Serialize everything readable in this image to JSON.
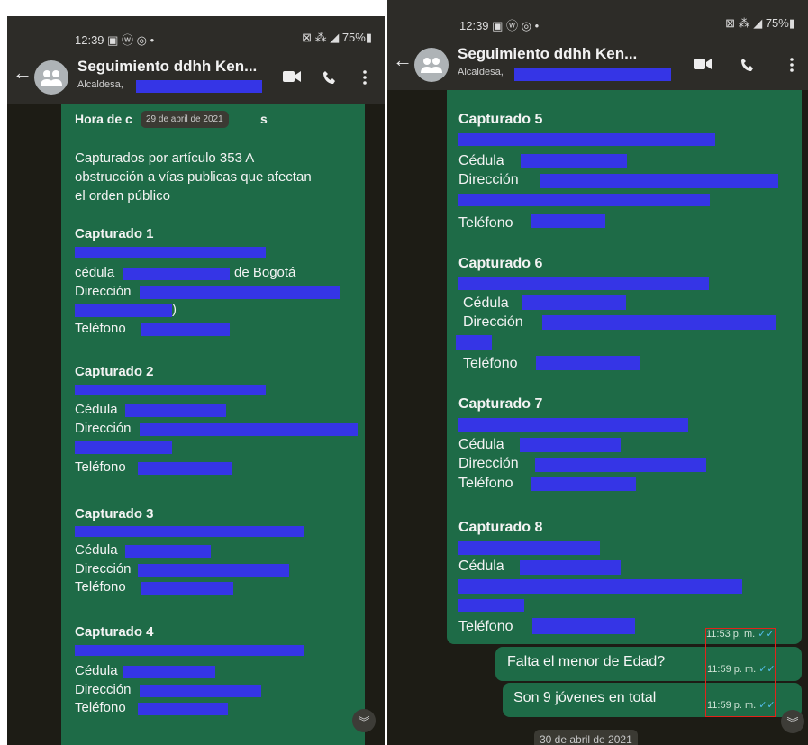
{
  "left_screen": {
    "status": {
      "time": "12:39 ▣ ⓦ ◎ •",
      "right": "⊠ ⁂ ◢ 75%▮"
    },
    "header": {
      "title": "Seguimiento ddhh Ken...",
      "subtitle": "Alcaldesa,"
    },
    "date_chip": "29 de abril de 2021",
    "message": {
      "heading_start": "Hora de c",
      "heading_end": "s",
      "intro": [
        "Capturados por artículo 353 A",
        "obstrucción a vías publicas que afectan",
        "el orden público"
      ],
      "c1_head": "Capturado 1",
      "c1_cedula": "cédula",
      "c1_bogota": "de Bogotá",
      "c1_dir": "Dirección",
      "c1_paren": ")",
      "c1_tel": "Teléfono",
      "c2_head": "Capturado 2",
      "c2_cedula": "Cédula",
      "c2_dir": "Dirección",
      "c2_tel": "Teléfono",
      "c3_head": "Capturado 3",
      "c3_cedula": "Cédula",
      "c3_dir": "Dirección",
      "c3_tel": "Teléfono",
      "c4_head": "Capturado 4",
      "c4_cedula": "Cédula",
      "c4_dir": "Dirección",
      "c4_tel": "Teléfono"
    }
  },
  "right_screen": {
    "status": {
      "time": "12:39 ▣ ⓦ ◎ •",
      "right": "⊠ ⁂ ◢ 75%▮"
    },
    "header": {
      "title": "Seguimiento ddhh Ken...",
      "subtitle": "Alcaldesa,"
    },
    "message": {
      "c5_head": "Capturado 5",
      "c5_cedula": "Cédula",
      "c5_dir": "Dirección",
      "c5_tel": "Teléfono",
      "c6_head": "Capturado 6",
      "c6_cedula": "Cédula",
      "c6_dir": "Dirección",
      "c6_tel": "Teléfono",
      "c7_head": "Capturado 7",
      "c7_cedula": "Cédula",
      "c7_dir": "Dirección",
      "c7_tel": "Teléfono",
      "c8_head": "Capturado 8",
      "c8_cedula": "Cédula",
      "c8_tel": "Teléfono",
      "time": "11:53 p. m.",
      "ticks": "✓✓"
    },
    "reply1": {
      "text": "Falta el menor de Edad?",
      "time": "11:59 p. m.",
      "ticks": "✓✓"
    },
    "reply2": {
      "text": "Son 9 jóvenes en total",
      "time": "11:59 p. m.",
      "ticks": "✓✓"
    },
    "date_chip": "30 de abril de 2021"
  },
  "icons": {
    "back": "←",
    "scroll_down": "︾",
    "menu": "⋮"
  },
  "colors": {
    "bubble": "#1e6b47",
    "redaction": "#3535e6",
    "highlight": "#e2231a",
    "chat_bg": "#1d1c15",
    "topbar": "#2d2c28"
  }
}
